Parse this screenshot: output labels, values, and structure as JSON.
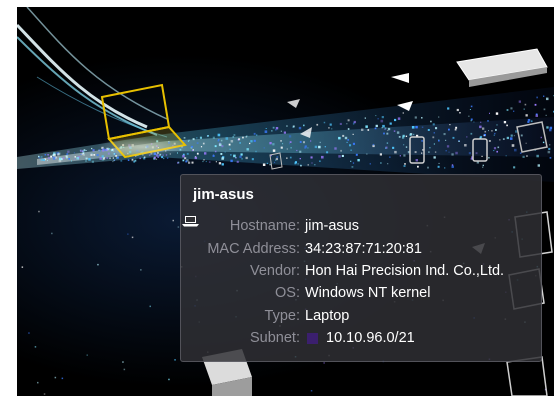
{
  "tooltip": {
    "title": "jim-asus",
    "rows": [
      {
        "label": "Hostname:",
        "value": "jim-asus"
      },
      {
        "label": "MAC Address:",
        "value": "34:23:87:71:20:81"
      },
      {
        "label": "Vendor:",
        "value": "Hon Hai Precision Ind. Co.,Ltd."
      },
      {
        "label": "OS:",
        "value": "Windows NT kernel"
      },
      {
        "label": "Type:",
        "value": "Laptop",
        "icon": "laptop-icon"
      },
      {
        "label": "Subnet:",
        "value": "10.10.96.0/21",
        "swatch_color": "#3b1f6e"
      }
    ]
  },
  "colors": {
    "highlight": "#e8c000",
    "beam": "#4fd6ff",
    "background": "#000000"
  }
}
